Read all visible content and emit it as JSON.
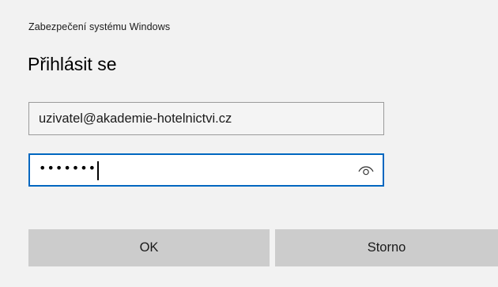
{
  "window": {
    "app_label": "Zabezpečení systému Windows",
    "title": "Přihlásit se"
  },
  "username": {
    "value": "uzivatel@akademie-hotelnictvi.cz"
  },
  "password": {
    "masked_value": "•••••••",
    "reveal_icon": "eye-icon",
    "focused": true
  },
  "buttons": {
    "ok_label": "OK",
    "cancel_label": "Storno"
  },
  "colors": {
    "background": "#f2f2f2",
    "focus_border": "#0067c0",
    "button_bg": "#cccccc"
  }
}
